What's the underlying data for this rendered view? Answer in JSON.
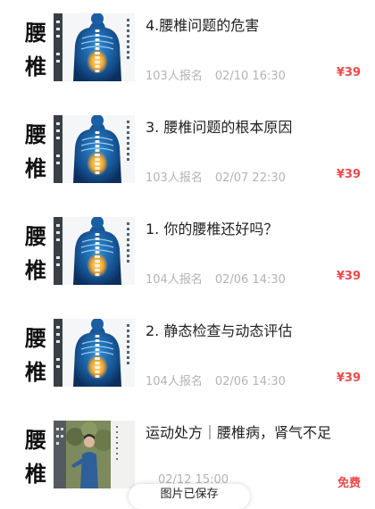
{
  "courses": [
    {
      "thumb_chars": [
        "腰",
        "椎"
      ],
      "title": "4.腰椎问题的危害",
      "enrolled": "103人报名",
      "datetime": "02/10 16:30",
      "price": "¥39",
      "thumb_style": "spine"
    },
    {
      "thumb_chars": [
        "腰",
        "椎"
      ],
      "title": "3. 腰椎问题的根本原因",
      "enrolled": "103人报名",
      "datetime": "02/07 22:30",
      "price": "¥39",
      "thumb_style": "spine"
    },
    {
      "thumb_chars": [
        "腰",
        "椎"
      ],
      "title": "1. 你的腰椎还好吗？",
      "enrolled": "104人报名",
      "datetime": "02/06 14:30",
      "price": "¥39",
      "thumb_style": "spine"
    },
    {
      "thumb_chars": [
        "腰",
        "椎"
      ],
      "title": "2. 静态检查与动态评估",
      "enrolled": "104人报名",
      "datetime": "02/06 14:30",
      "price": "¥39",
      "thumb_style": "spine"
    },
    {
      "thumb_chars": [
        "腰",
        "椎"
      ],
      "title": "运动处方｜腰椎病，肾气不足",
      "enrolled": "",
      "datetime": "02/12 15:00",
      "price": "免费",
      "thumb_style": "photo"
    }
  ],
  "toast": {
    "text": "图片已保存"
  },
  "colors": {
    "price": "#f04848",
    "meta": "#b4b4b4",
    "title": "#222222"
  }
}
